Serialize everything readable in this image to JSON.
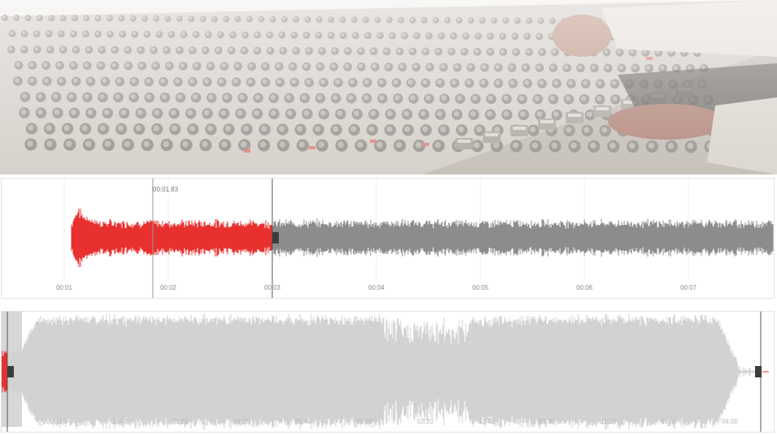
{
  "hero": {
    "image": "mixing-console-photo"
  },
  "zoom_view": {
    "hover_time": "00:01.83",
    "ticks": [
      "00:01",
      "00:02",
      "00:03",
      "00:04",
      "00:05",
      "00:06",
      "00:07"
    ],
    "played_color": "#e8302f",
    "unplayed_color": "#8c8c8c",
    "cursor_color": "#555555"
  },
  "overview": {
    "ticks": [
      "00:20",
      "00:40",
      "01:00",
      "01:20",
      "01:40",
      "02:00",
      "02:20",
      "02:40",
      "03:00",
      "03:20",
      "03:40",
      "04:00"
    ],
    "waveform_color": "#d2d2d2",
    "played_color": "#e8302f",
    "selection_color": "#c9c9c9"
  }
}
